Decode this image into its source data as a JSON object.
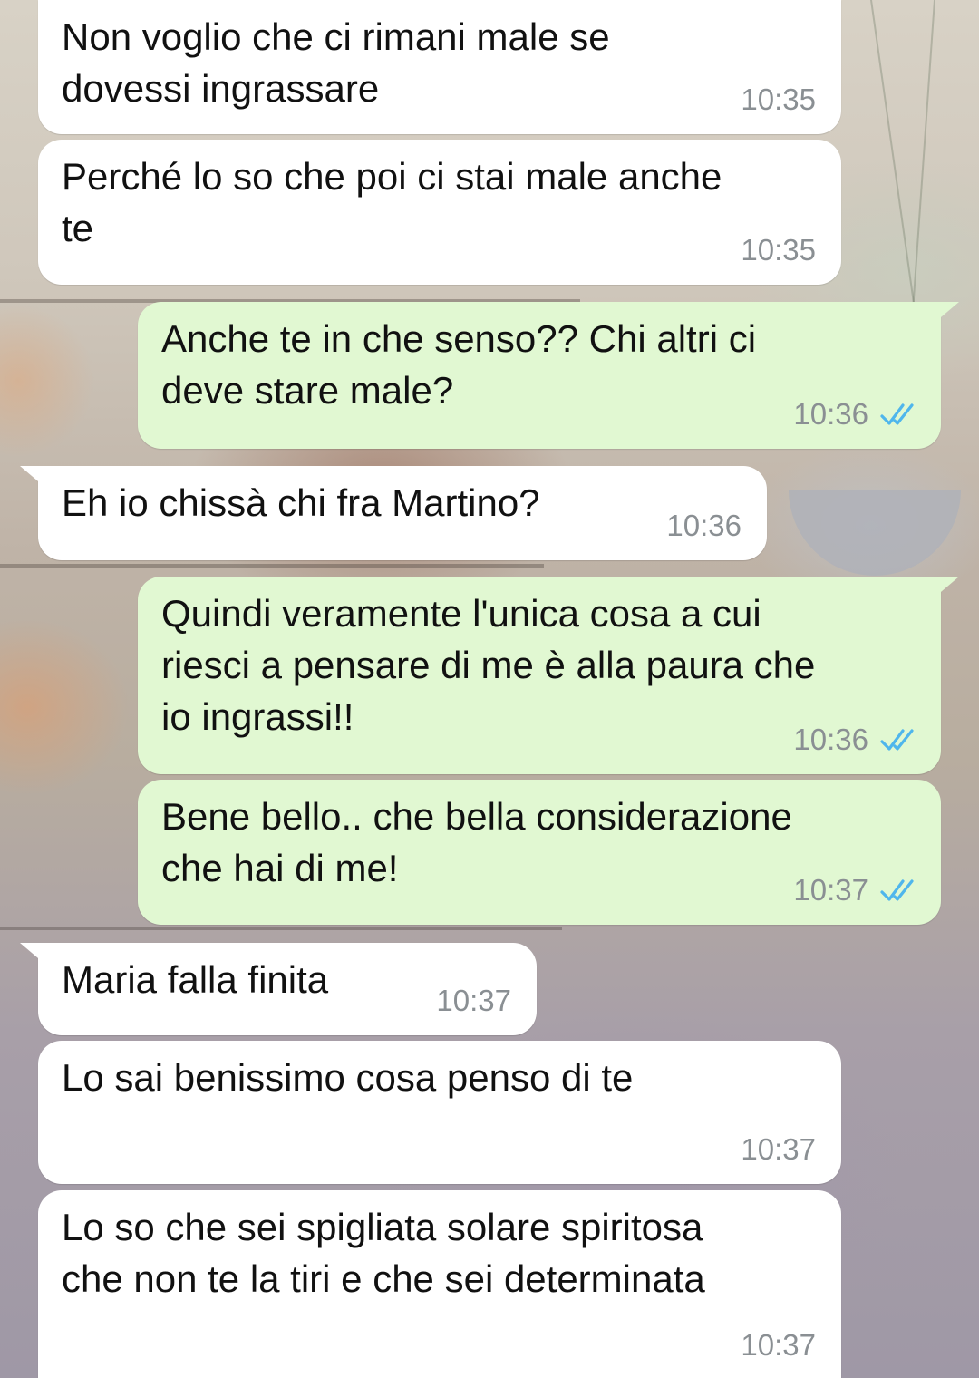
{
  "messages": [
    {
      "direction": "in",
      "text": "Non voglio che ci rimani male se\ndovessi ingrassare",
      "time": "10:35"
    },
    {
      "direction": "in",
      "text": "Perché lo so che poi ci stai male anche\nte",
      "time": "10:35"
    },
    {
      "direction": "out",
      "text": "Anche te in che senso?? Chi altri ci\ndeve stare male?",
      "time": "10:36",
      "status": "read"
    },
    {
      "direction": "in",
      "text": "Eh io chissà chi fra Martino?",
      "time": "10:36"
    },
    {
      "direction": "out",
      "text": "Quindi veramente l'unica cosa a cui\nriesci a pensare di me è alla paura che\nio ingrassi!!",
      "time": "10:36",
      "status": "read"
    },
    {
      "direction": "out",
      "text": "Bene bello.. che bella considerazione\nche hai di me!",
      "time": "10:37",
      "status": "read"
    },
    {
      "direction": "in",
      "text": "Maria falla finita",
      "time": "10:37"
    },
    {
      "direction": "in",
      "text": "Lo sai benissimo cosa penso di te",
      "time": "10:37"
    },
    {
      "direction": "in",
      "text": "Lo so che sei spigliata solare spiritosa\nche non te la tiri e che sei determinata",
      "time": "10:37"
    }
  ],
  "colors": {
    "incoming_bubble": "#ffffff",
    "outgoing_bubble": "#e1f8d2",
    "timestamp": "#8a8f93",
    "read_ticks": "#4fb6ec"
  },
  "icons": {
    "read_status": "double-check-icon"
  }
}
